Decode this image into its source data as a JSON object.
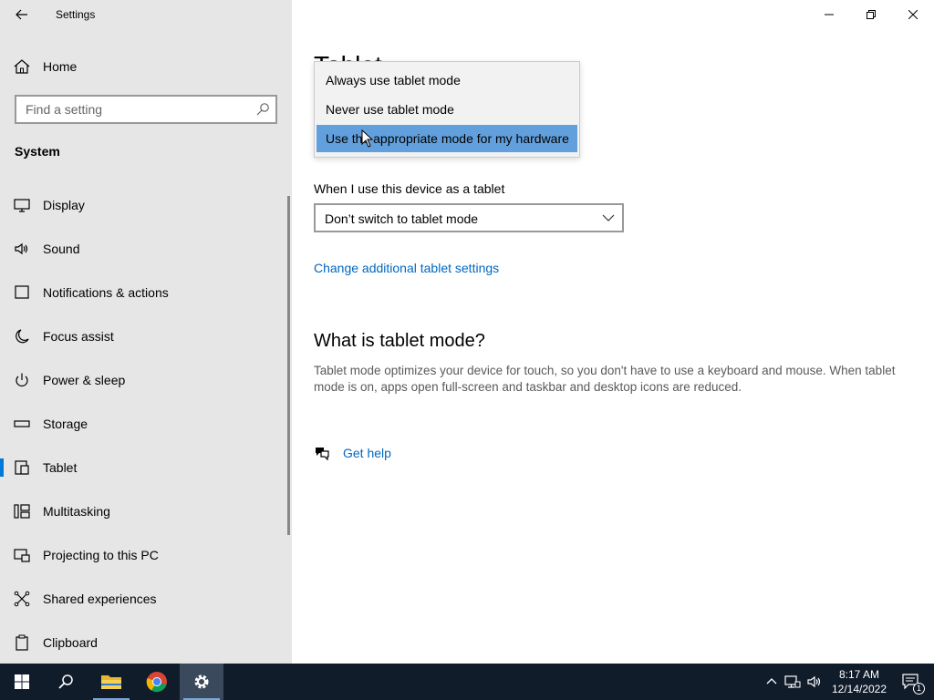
{
  "window": {
    "title": "Settings"
  },
  "sidebar": {
    "home_label": "Home",
    "search_placeholder": "Find a setting",
    "section_title": "System",
    "items": [
      {
        "label": "Display",
        "icon": "monitor-icon"
      },
      {
        "label": "Sound",
        "icon": "speaker-icon"
      },
      {
        "label": "Notifications & actions",
        "icon": "notification-icon"
      },
      {
        "label": "Focus assist",
        "icon": "moon-icon"
      },
      {
        "label": "Power & sleep",
        "icon": "power-icon"
      },
      {
        "label": "Storage",
        "icon": "storage-icon"
      },
      {
        "label": "Tablet",
        "icon": "tablet-icon",
        "active": true
      },
      {
        "label": "Multitasking",
        "icon": "multitasking-icon"
      },
      {
        "label": "Projecting to this PC",
        "icon": "projecting-icon"
      },
      {
        "label": "Shared experiences",
        "icon": "shared-icon"
      },
      {
        "label": "Clipboard",
        "icon": "clipboard-icon"
      }
    ]
  },
  "main": {
    "page_title": "Tablet",
    "dropdown_options": [
      "Always use tablet mode",
      "Never use tablet mode",
      "Use the appropriate mode for my hardware"
    ],
    "selected_option": "Use the appropriate mode for my hardware",
    "device_label": "When I use this device as a tablet",
    "device_value": "Don’t switch to tablet mode",
    "additional_link": "Change additional tablet settings",
    "what_heading": "What is tablet mode?",
    "what_desc": "Tablet mode optimizes your device for touch, so you don't have to use a keyboard and mouse. When tablet mode is on, apps open full-screen and taskbar and desktop icons are reduced.",
    "help_label": "Get help"
  },
  "taskbar": {
    "time": "8:17 AM",
    "date": "12/14/2022",
    "notification_count": "1"
  },
  "colors": {
    "accent": "#0078d7",
    "link": "#0067c0",
    "selection": "#62a0dd",
    "sidebar_bg": "#e6e6e6",
    "taskbar_bg": "#101c2a"
  }
}
